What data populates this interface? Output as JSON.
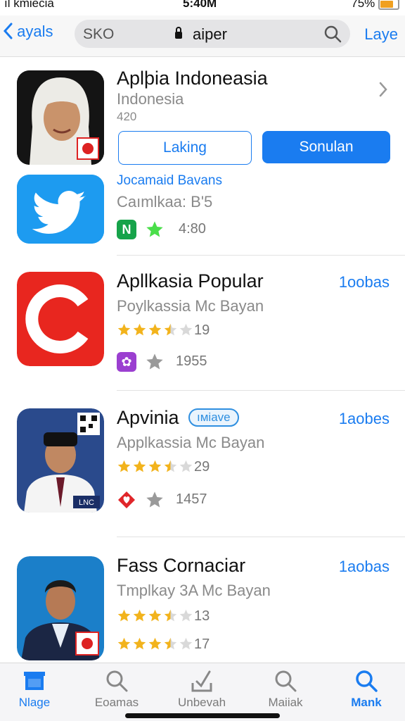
{
  "status": {
    "carrier": "ıl kmiecia",
    "time": "5:40M",
    "battery": "75%"
  },
  "nav": {
    "back_label": "ayals",
    "search_left": "SKO",
    "search_query": "aiper",
    "right_label": "Laye"
  },
  "featured": {
    "title": "Aplþia Indoneasia",
    "subtitle": "Indonesia",
    "meta": "420",
    "btn_left": "Laking",
    "btn_right": "Sonulan",
    "second_title": "Jocamaid Bavans",
    "second_sub": "Caımlkaa: B'5",
    "second_rating": "4:80"
  },
  "apps": [
    {
      "title": "Apllkasia Popular",
      "subtitle": "Poylkassia Mc Bayan",
      "count": "19",
      "extra": "1955",
      "get": "1oobas",
      "stars": 3.5
    },
    {
      "title": "Apvinia",
      "badge": "ıмiave",
      "subtitle": "Applkassia Mc Bayan",
      "count": "29",
      "extra": "1457",
      "get": "1aobes",
      "stars": 3.5
    },
    {
      "title": "Fass Cornaciar",
      "subtitle": "Tmplkay 3A Mc Bayan",
      "count": "13",
      "extra": "17",
      "get": "1aobas",
      "stars": 3.5
    }
  ],
  "tabs": [
    {
      "label": "Nlage",
      "icon": "home-icon"
    },
    {
      "label": "Eoamas",
      "icon": "search-icon"
    },
    {
      "label": "Unbevah",
      "icon": "update-icon"
    },
    {
      "label": "Maiiak",
      "icon": "search-icon"
    },
    {
      "label": "Mank",
      "icon": "search-icon"
    }
  ],
  "colors": {
    "accent": "#1a7cf0",
    "star": "#f2b31c",
    "red_icon": "#e8261f",
    "twitter": "#1d9bf0"
  }
}
